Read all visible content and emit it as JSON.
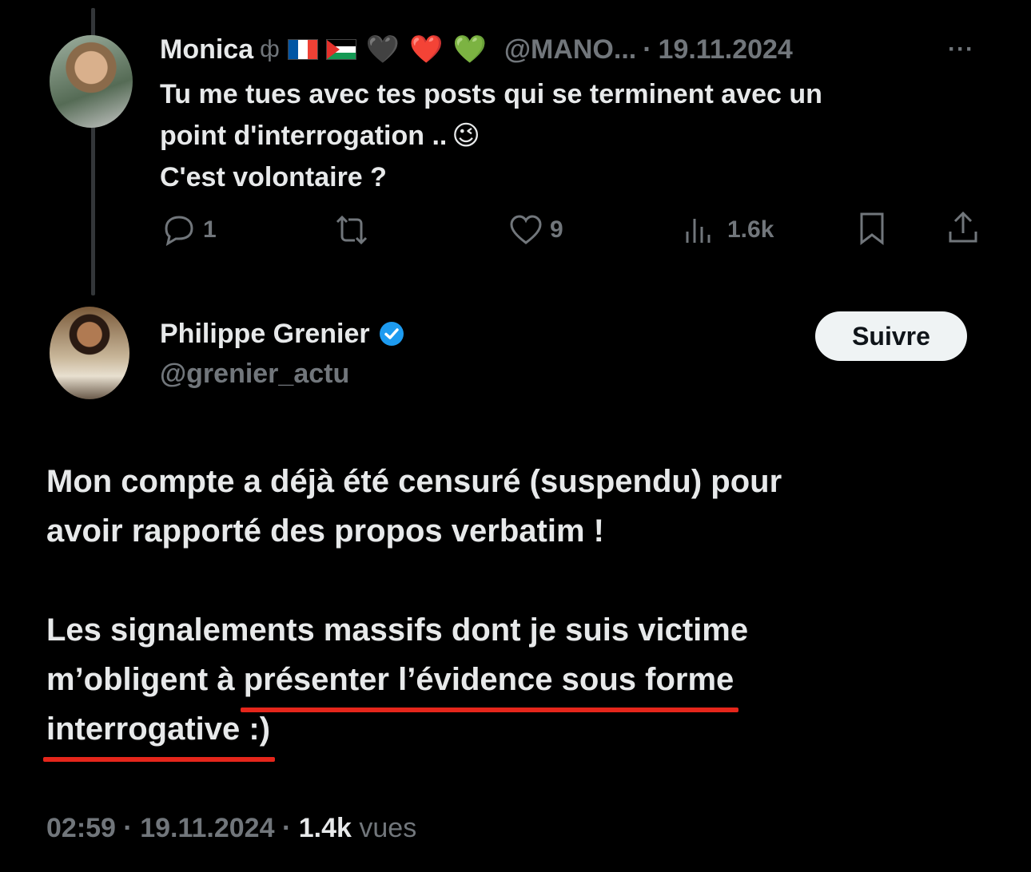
{
  "reply": {
    "name": "Monica",
    "name_symbol": "ф",
    "hearts": [
      "🖤",
      "❤️",
      "💚"
    ],
    "handle": "@MANO...",
    "date_sep": "·",
    "date": "19.11.2024",
    "more": "···",
    "lines": [
      "Tu me tues avec tes posts qui se terminent avec un",
      "point d'interrogation ..",
      "C'est volontaire ?"
    ],
    "wink": "😉",
    "actions": {
      "replies": "1",
      "likes": "9",
      "views": "1.6k"
    }
  },
  "post": {
    "name": "Philippe Grenier",
    "handle": "@grenier_actu",
    "follow_label": "Suivre",
    "paragraph1": [
      "Mon compte a déjà été censuré (suspendu) pour",
      "avoir rapporté des propos verbatim !"
    ],
    "paragraph2_line1": "Les signalements massifs dont je suis victime",
    "paragraph2_line2_start": "m’obligent à ",
    "paragraph2_line2_underlined": "présenter l’évidence sous forme",
    "paragraph2_line3_underlined": "interrogative :)",
    "footer": {
      "time": "02:59",
      "sep1": "·",
      "date": "19.11.2024",
      "sep2": "·",
      "views": "1.4k",
      "views_label": "vues"
    }
  },
  "colors": {
    "background": "#000000",
    "text": "#e7e9ea",
    "muted": "#71767b",
    "underline": "#e5261b",
    "verified": "#1d9bf0"
  }
}
